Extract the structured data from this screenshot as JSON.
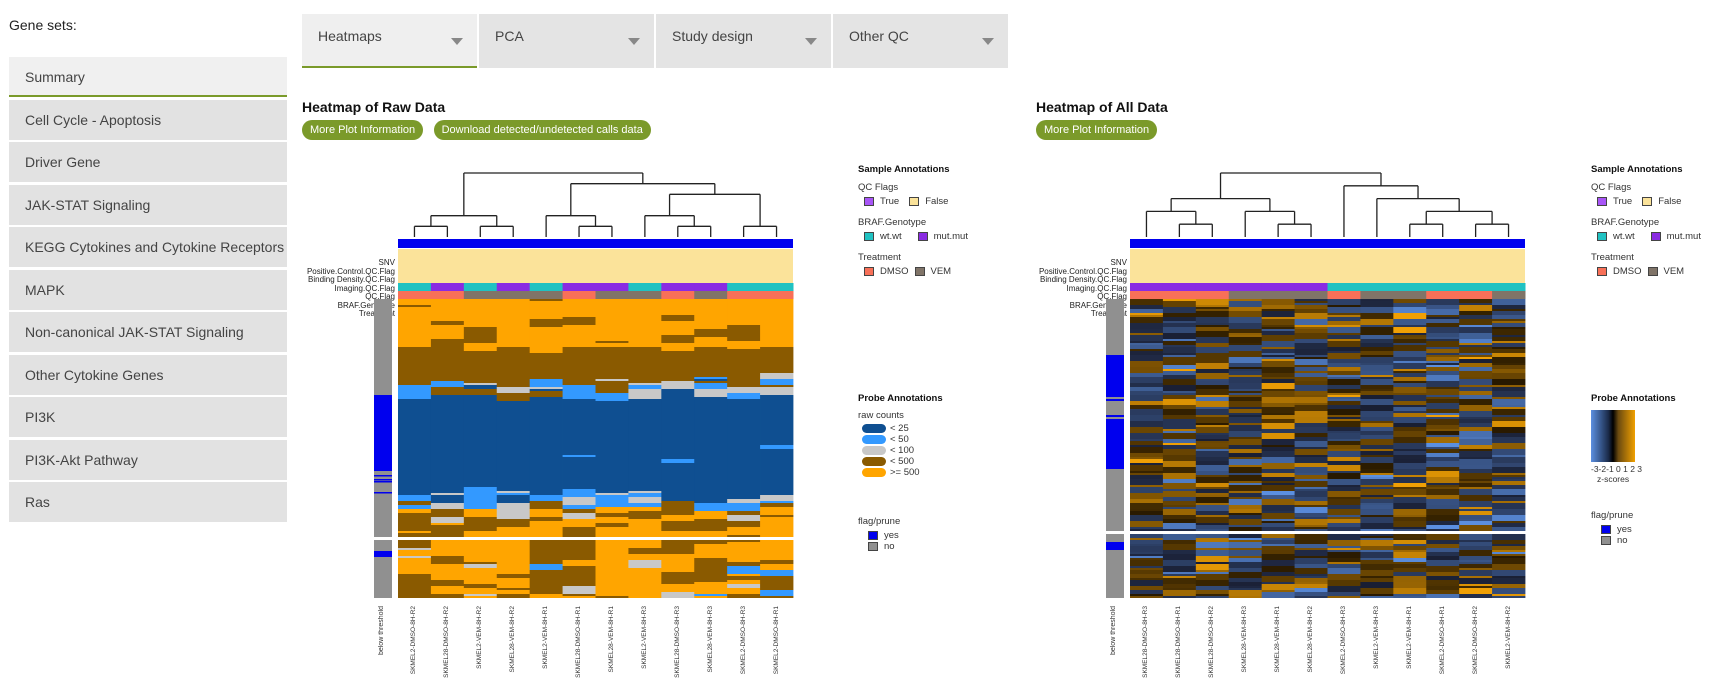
{
  "sidebar": {
    "label": "Gene sets:",
    "items": [
      {
        "label": "Summary",
        "active": true
      },
      {
        "label": "Cell Cycle - Apoptosis"
      },
      {
        "label": "Driver Gene"
      },
      {
        "label": "JAK-STAT Signaling"
      },
      {
        "label": "KEGG Cytokines and Cytokine Receptors"
      },
      {
        "label": "MAPK"
      },
      {
        "label": "Non-canonical JAK-STAT Signaling"
      },
      {
        "label": "Other Cytokine Genes"
      },
      {
        "label": "PI3K"
      },
      {
        "label": "PI3K-Akt Pathway"
      },
      {
        "label": "Ras"
      }
    ]
  },
  "tabs": [
    {
      "label": "Heatmaps",
      "active": true
    },
    {
      "label": "PCA"
    },
    {
      "label": "Study design"
    },
    {
      "label": "Other QC"
    }
  ],
  "colors": {
    "accent": "#7b9a2a",
    "snv": "#0000ee",
    "qc_false": "#fbe39a",
    "qc_true": "#a855f7",
    "wt": "#20c2c2",
    "mut": "#8a2be2",
    "dmso": "#f87058",
    "vem": "#807468",
    "flag_yes": "#0000ee",
    "flag_no": "#909090",
    "raw": [
      "#0f4f91",
      "#3399ff",
      "#c8c8c8",
      "#8a5a00",
      "#ffa500"
    ],
    "z_low": "#5b8fe0",
    "z_mid": "#000000",
    "z_high": "#f0a000"
  },
  "left_plot": {
    "title": "Heatmap of Raw Data",
    "buttons": [
      "More Plot Information",
      "Download detected/undetected calls data"
    ],
    "annotation_rows": [
      "SNV",
      "Positive.Control.QC.Flag",
      "Binding Density.QC.Flag",
      "Imaging.QC.Flag",
      "QC.Flag",
      "BRAF.Genotype",
      "Treatment"
    ],
    "row_side_label": "below threshold",
    "columns": [
      "SKMEL2-DMSO-8H-R2",
      "SKMEL28-DMSO-8H-R2",
      "SKMEL2-VEM-8H-R2",
      "SKMEL28-VEM-8H-R2",
      "SKMEL2-VEM-8H-R1",
      "SKMEL28-DMSO-8H-R1",
      "SKMEL28-VEM-8H-R1",
      "SKMEL2-VEM-8H-R3",
      "SKMEL28-DMSO-8H-R3",
      "SKMEL28-VEM-8H-R3",
      "SKMEL2-DMSO-8H-R3",
      "SKMEL2-DMSO-8H-R1"
    ],
    "genotype": [
      "wt",
      "mut",
      "wt",
      "mut",
      "wt",
      "mut",
      "mut",
      "wt",
      "mut",
      "mut",
      "wt",
      "wt"
    ],
    "treatment": [
      "dmso",
      "dmso",
      "vem",
      "vem",
      "vem",
      "dmso",
      "vem",
      "vem",
      "dmso",
      "vem",
      "dmso",
      "dmso"
    ],
    "legend": {
      "sample_header": "Sample Annotations",
      "qc_title": "QC Flags",
      "qc_true": "True",
      "qc_false": "False",
      "geno_title": "BRAF.Genotype",
      "geno_wt": "wt.wt",
      "geno_mut": "mut.mut",
      "treat_title": "Treatment",
      "treat_dmso": "DMSO",
      "treat_vem": "VEM",
      "probe_header": "Probe Annotations",
      "scale_title": "raw counts",
      "scale_bins": [
        "< 25",
        "< 50",
        "< 100",
        "< 500",
        ">= 500"
      ],
      "flag_title": "flag/prune",
      "flag_yes": "yes",
      "flag_no": "no"
    }
  },
  "right_plot": {
    "title": "Heatmap of All Data",
    "buttons": [
      "More Plot Information"
    ],
    "annotation_rows": [
      "SNV",
      "Positive.Control.QC.Flag",
      "Binding Density.QC.Flag",
      "Imaging.QC.Flag",
      "QC.Flag",
      "BRAF.Genotype",
      "Treatment"
    ],
    "row_side_label": "below threshold",
    "columns": [
      "SKMEL28-DMSO-8H-R3",
      "SKMEL28-DMSO-8H-R1",
      "SKMEL28-DMSO-8H-R2",
      "SKMEL28-VEM-8H-R3",
      "SKMEL28-VEM-8H-R1",
      "SKMEL28-VEM-8H-R2",
      "SKMEL2-DMSO-8H-R3",
      "SKMEL2-VEM-8H-R3",
      "SKMEL2-VEM-8H-R1",
      "SKMEL2-DMSO-8H-R1",
      "SKMEL2-DMSO-8H-R2",
      "SKMEL2-VEM-8H-R2"
    ],
    "genotype": [
      "mut",
      "mut",
      "mut",
      "mut",
      "mut",
      "mut",
      "wt",
      "wt",
      "wt",
      "wt",
      "wt",
      "wt"
    ],
    "treatment": [
      "dmso",
      "dmso",
      "dmso",
      "vem",
      "vem",
      "vem",
      "dmso",
      "vem",
      "vem",
      "dmso",
      "dmso",
      "vem"
    ],
    "legend": {
      "sample_header": "Sample Annotations",
      "qc_title": "QC Flags",
      "qc_true": "True",
      "qc_false": "False",
      "geno_title": "BRAF.Genotype",
      "geno_wt": "wt.wt",
      "geno_mut": "mut.mut",
      "treat_title": "Treatment",
      "treat_dmso": "DMSO",
      "treat_vem": "VEM",
      "probe_header": "Probe Annotations",
      "scale_ticks": "-3-2-1 0 1 2 3",
      "scale_title": "z-scores",
      "flag_title": "flag/prune",
      "flag_yes": "yes",
      "flag_no": "no"
    }
  }
}
